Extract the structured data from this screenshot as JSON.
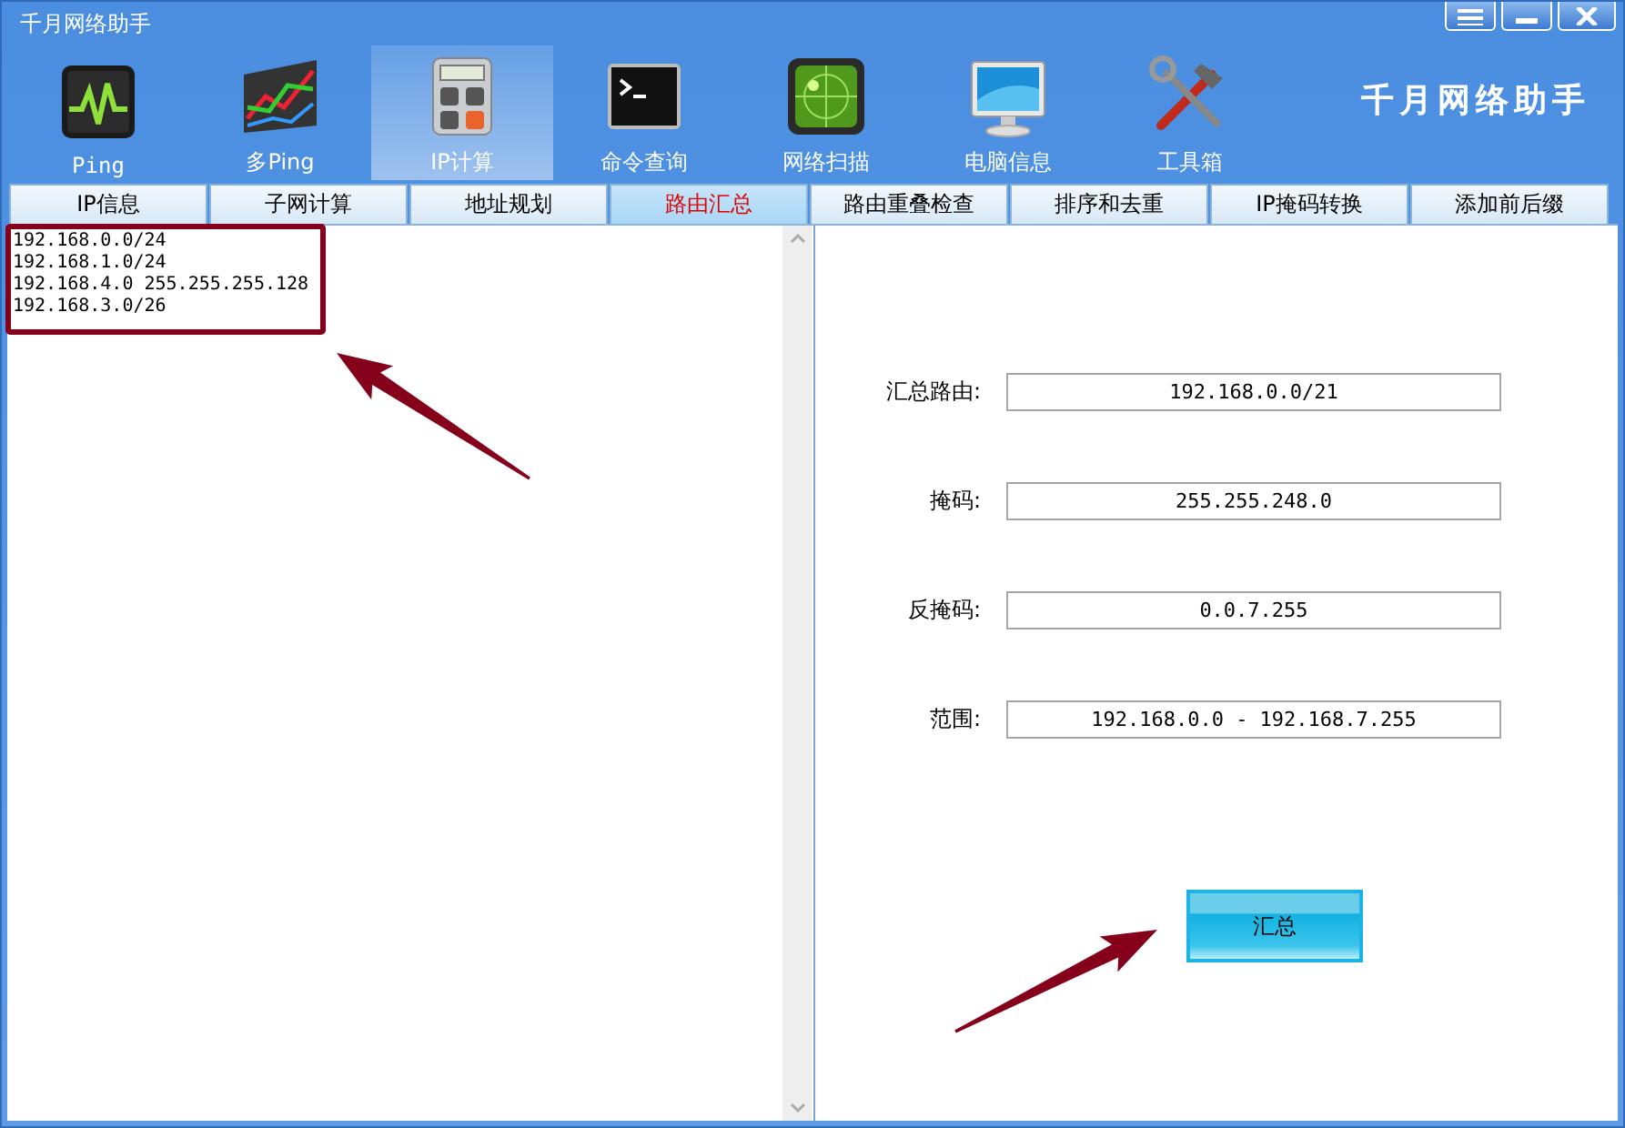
{
  "window": {
    "title": "千月网络助手"
  },
  "toolbar": {
    "items": [
      {
        "label": "Ping",
        "selected": false
      },
      {
        "label": "多Ping",
        "selected": false
      },
      {
        "label": "IP计算",
        "selected": true
      },
      {
        "label": "命令查询",
        "selected": false
      },
      {
        "label": "网络扫描",
        "selected": false
      },
      {
        "label": "电脑信息",
        "selected": false
      },
      {
        "label": "工具箱",
        "selected": false
      }
    ],
    "logo": "千月网络助手"
  },
  "tabs": [
    {
      "label": "IP信息",
      "selected": false
    },
    {
      "label": "子网计算",
      "selected": false
    },
    {
      "label": "地址规划",
      "selected": false
    },
    {
      "label": "路由汇总",
      "selected": true
    },
    {
      "label": "路由重叠检查",
      "selected": false
    },
    {
      "label": "排序和去重",
      "selected": false
    },
    {
      "label": "IP掩码转换",
      "selected": false
    },
    {
      "label": "添加前后缀",
      "selected": false
    }
  ],
  "input": {
    "lines": [
      "192.168.0.0/24",
      "192.168.1.0/24",
      "192.168.4.0 255.255.255.128",
      "192.168.3.0/26"
    ]
  },
  "results": [
    {
      "label": "汇总路由:",
      "value": "192.168.0.0/21"
    },
    {
      "label": "掩码:",
      "value": "255.255.248.0"
    },
    {
      "label": "反掩码:",
      "value": "0.0.7.255"
    },
    {
      "label": "范围:",
      "value": "192.168.0.0 - 192.168.7.255"
    }
  ],
  "button": {
    "label": "汇总"
  }
}
